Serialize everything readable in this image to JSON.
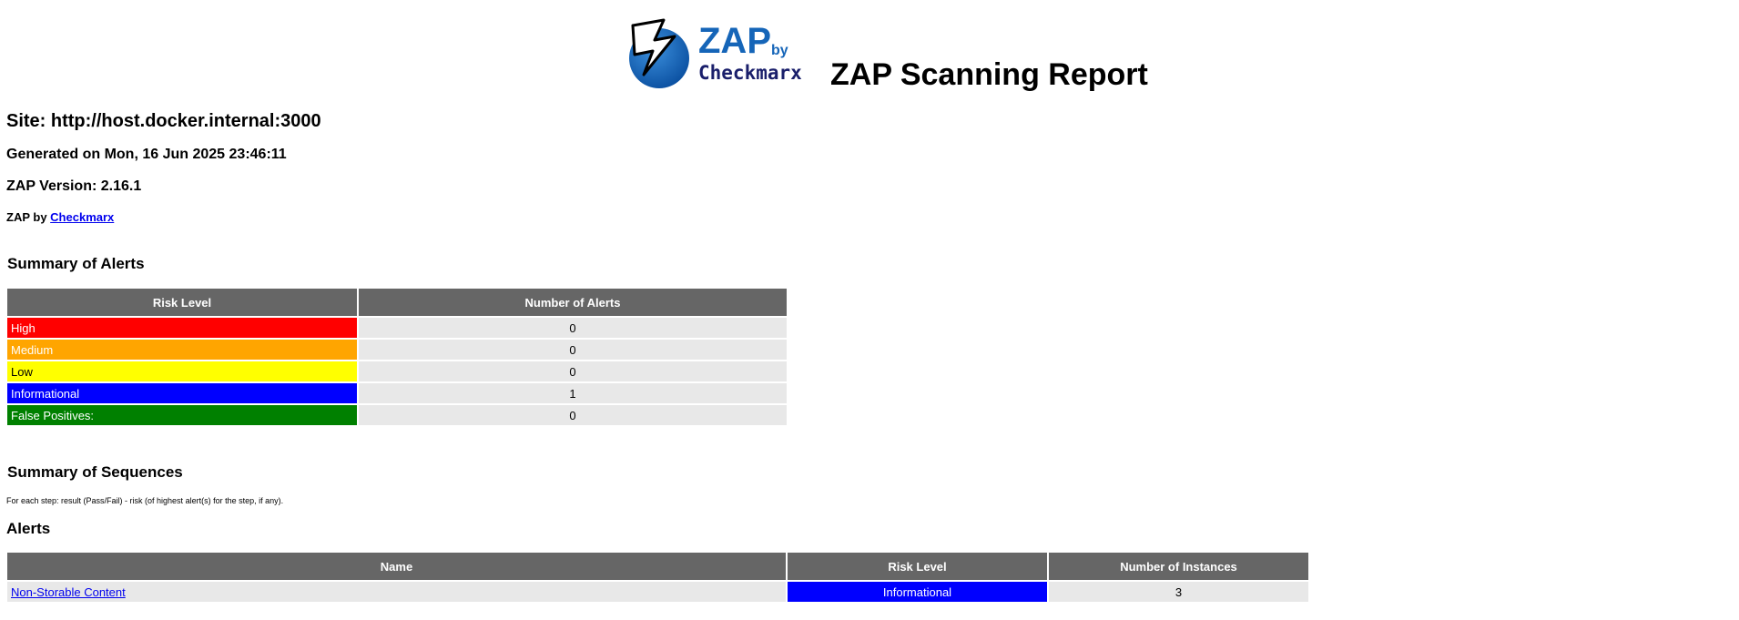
{
  "header": {
    "logo": {
      "name": "ZAP",
      "by": "by",
      "brand": "Checkmarx"
    },
    "title": "ZAP Scanning Report"
  },
  "site_line": "Site: http://host.docker.internal:3000",
  "generated_line": "Generated on Mon, 16 Jun 2025 23:46:11",
  "version_line": "ZAP Version: 2.16.1",
  "byline": {
    "prefix": "ZAP by ",
    "link": "Checkmarx"
  },
  "summary": {
    "title": "Summary of Alerts",
    "headers": [
      "Risk Level",
      "Number of Alerts"
    ],
    "rows": [
      {
        "level": "High",
        "count": "0",
        "color": "#ff0000"
      },
      {
        "level": "Medium",
        "count": "0",
        "color": "#ffa500"
      },
      {
        "level": "Low",
        "count": "0",
        "color": "#ffff00"
      },
      {
        "level": "Informational",
        "count": "1",
        "color": "#0000ff"
      },
      {
        "level": "False Positives:",
        "count": "0",
        "color": "#008000"
      }
    ]
  },
  "sequences": {
    "title": "Summary of Sequences",
    "note": "For each step: result (Pass/Fail) - risk (of highest alert(s) for the step, if any)."
  },
  "alerts": {
    "title": "Alerts",
    "headers": [
      "Name",
      "Risk Level",
      "Number of Instances"
    ],
    "rows": [
      {
        "name": "Non-Storable Content",
        "risk": "Informational",
        "instances": "3"
      }
    ]
  },
  "colors": {
    "header_bg": "#666666",
    "zebra": "#e8e8e8",
    "link": "#0000ee"
  }
}
